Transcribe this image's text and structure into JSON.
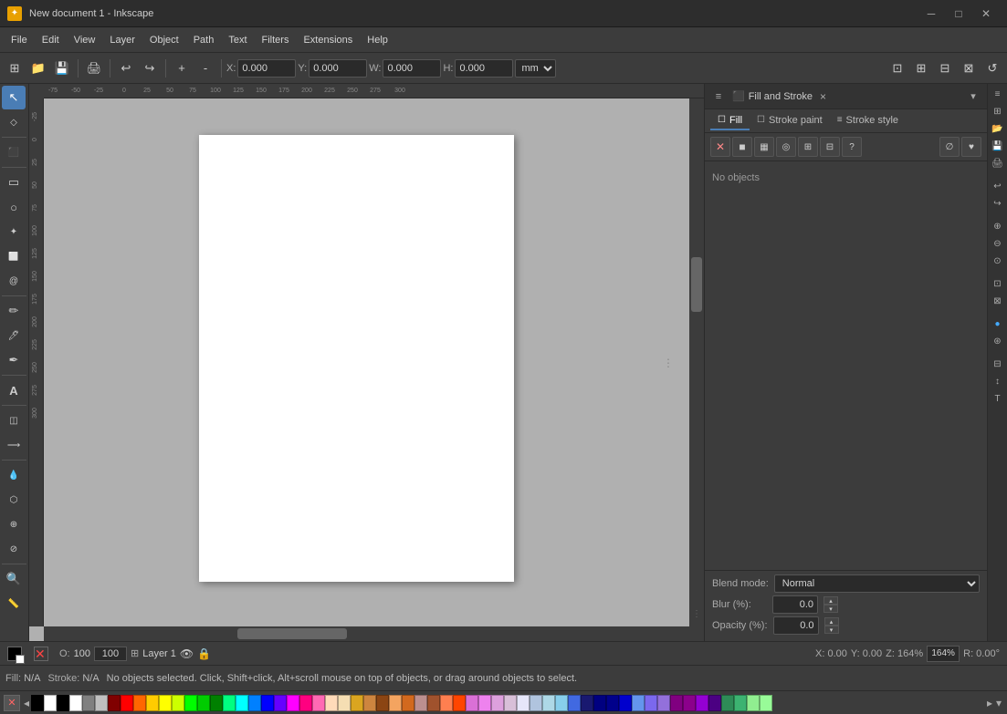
{
  "titlebar": {
    "title": "New document 1 - Inkscape",
    "app_icon": "★",
    "min_btn": "─",
    "max_btn": "□",
    "close_btn": "✕"
  },
  "menubar": {
    "items": [
      "File",
      "Edit",
      "View",
      "Layer",
      "Object",
      "Path",
      "Text",
      "Filters",
      "Extensions",
      "Help"
    ]
  },
  "toolbar": {
    "x_label": "X:",
    "x_value": "0.000",
    "y_label": "Y:",
    "y_value": "0.000",
    "w_label": "W:",
    "w_value": "0.000",
    "h_label": "H:",
    "h_value": "0.000",
    "unit": "mm"
  },
  "left_tools": {
    "tools": [
      {
        "name": "select-tool",
        "icon": "↖",
        "active": true
      },
      {
        "name": "node-tool",
        "icon": "◇"
      },
      {
        "name": "tweak-tool",
        "icon": "⊙"
      },
      {
        "name": "zoom-tool",
        "icon": "⬛"
      },
      {
        "name": "rect-tool",
        "icon": "▭"
      },
      {
        "name": "circle-tool",
        "icon": "○"
      },
      {
        "name": "star-tool",
        "icon": "✦"
      },
      {
        "name": "3d-box-tool",
        "icon": "⬜"
      },
      {
        "name": "spiral-tool",
        "icon": "🌀"
      },
      {
        "name": "pencil-tool",
        "icon": "✏"
      },
      {
        "name": "pen-tool",
        "icon": "🖊"
      },
      {
        "name": "calligraphy-tool",
        "icon": "✒"
      },
      {
        "name": "text-tool",
        "icon": "A"
      },
      {
        "name": "gradient-tool",
        "icon": "◫"
      },
      {
        "name": "connector-tool",
        "icon": "⟶"
      },
      {
        "name": "dropper-tool",
        "icon": "💧"
      },
      {
        "name": "paint-bucket-tool",
        "icon": "🪣"
      },
      {
        "name": "spray-tool",
        "icon": "⊕"
      },
      {
        "name": "eraser-tool",
        "icon": "⊘"
      },
      {
        "name": "zoom-view-tool",
        "icon": "🔍"
      },
      {
        "name": "measure-tool",
        "icon": "📏"
      }
    ]
  },
  "right_panel": {
    "title": "Fill and Stroke",
    "close_label": "×",
    "tabs": [
      {
        "name": "fill-tab",
        "label": "Fill",
        "active": true
      },
      {
        "name": "stroke-paint-tab",
        "label": "Stroke paint"
      },
      {
        "name": "stroke-style-tab",
        "label": "Stroke style"
      }
    ],
    "fill_options": [
      {
        "name": "none-btn",
        "icon": "✕"
      },
      {
        "name": "flat-color-btn",
        "icon": "■"
      },
      {
        "name": "linear-grad-btn",
        "icon": "▦"
      },
      {
        "name": "radial-grad-btn",
        "icon": "◎"
      },
      {
        "name": "pattern-btn",
        "icon": "⊞"
      },
      {
        "name": "swatch-btn",
        "icon": "⊟"
      },
      {
        "name": "unknown-btn",
        "icon": "?"
      },
      {
        "name": "unset-btn",
        "icon": "∅"
      }
    ],
    "no_objects_text": "No objects",
    "blend_mode_label": "Blend mode:",
    "blend_mode_value": "Normal",
    "blur_label": "Blur (%):",
    "blur_value": "0.0",
    "opacity_label": "Opacity (%):",
    "opacity_value": "0.0"
  },
  "statusbar": {
    "no_selection_text": "No objects selected. Click, Shift+click, Alt+scroll mouse on top of objects, or drag around objects to select.",
    "fill_label": "Fill:",
    "fill_value": "N/A",
    "stroke_label": "Stroke:",
    "stroke_value": "N/A",
    "opacity_label": "O:",
    "opacity_value": "100",
    "layer_label": "Layer 1",
    "x_coord": "X: 0.00",
    "y_coord": "Y: 0.00",
    "zoom_label": "Z: 164%",
    "rotation_label": "R: 0.00°"
  },
  "palette": {
    "colors": [
      "#000000",
      "#ffffff",
      "#808080",
      "#c0c0c0",
      "#800000",
      "#ff0000",
      "#ff6600",
      "#ffcc00",
      "#ffff00",
      "#ccff00",
      "#00ff00",
      "#00cc00",
      "#008000",
      "#00ff80",
      "#00ffff",
      "#0080ff",
      "#0000ff",
      "#6600ff",
      "#ff00ff",
      "#ff0080",
      "#ff69b4",
      "#ffdab9",
      "#f5deb3",
      "#daa520",
      "#cd853f",
      "#8b4513",
      "#f4a460",
      "#d2691e",
      "#bc8f8f",
      "#a0522d",
      "#ff7f50",
      "#ff4500",
      "#da70d6",
      "#ee82ee",
      "#dda0dd",
      "#d8bfd8",
      "#e6e6fa",
      "#b0c4de",
      "#add8e6",
      "#87ceeb",
      "#4169e1",
      "#191970",
      "#000080",
      "#00008b",
      "#0000cd",
      "#6495ed",
      "#7b68ee",
      "#9370db",
      "#800080",
      "#8b008b",
      "#9400d3",
      "#4b0082",
      "#2e8b57",
      "#3cb371",
      "#90ee90",
      "#98fb98"
    ]
  },
  "canvas": {
    "rulers": {
      "h_marks": [
        "-75",
        "-50",
        "-25",
        "0",
        "25",
        "50",
        "75",
        "100",
        "125",
        "150",
        "175",
        "200",
        "225",
        "250",
        "275",
        "300"
      ],
      "v_marks": [
        "0",
        "25",
        "50",
        "75",
        "100",
        "125",
        "150",
        "175",
        "200",
        "225",
        "250",
        "275",
        "300"
      ]
    }
  }
}
